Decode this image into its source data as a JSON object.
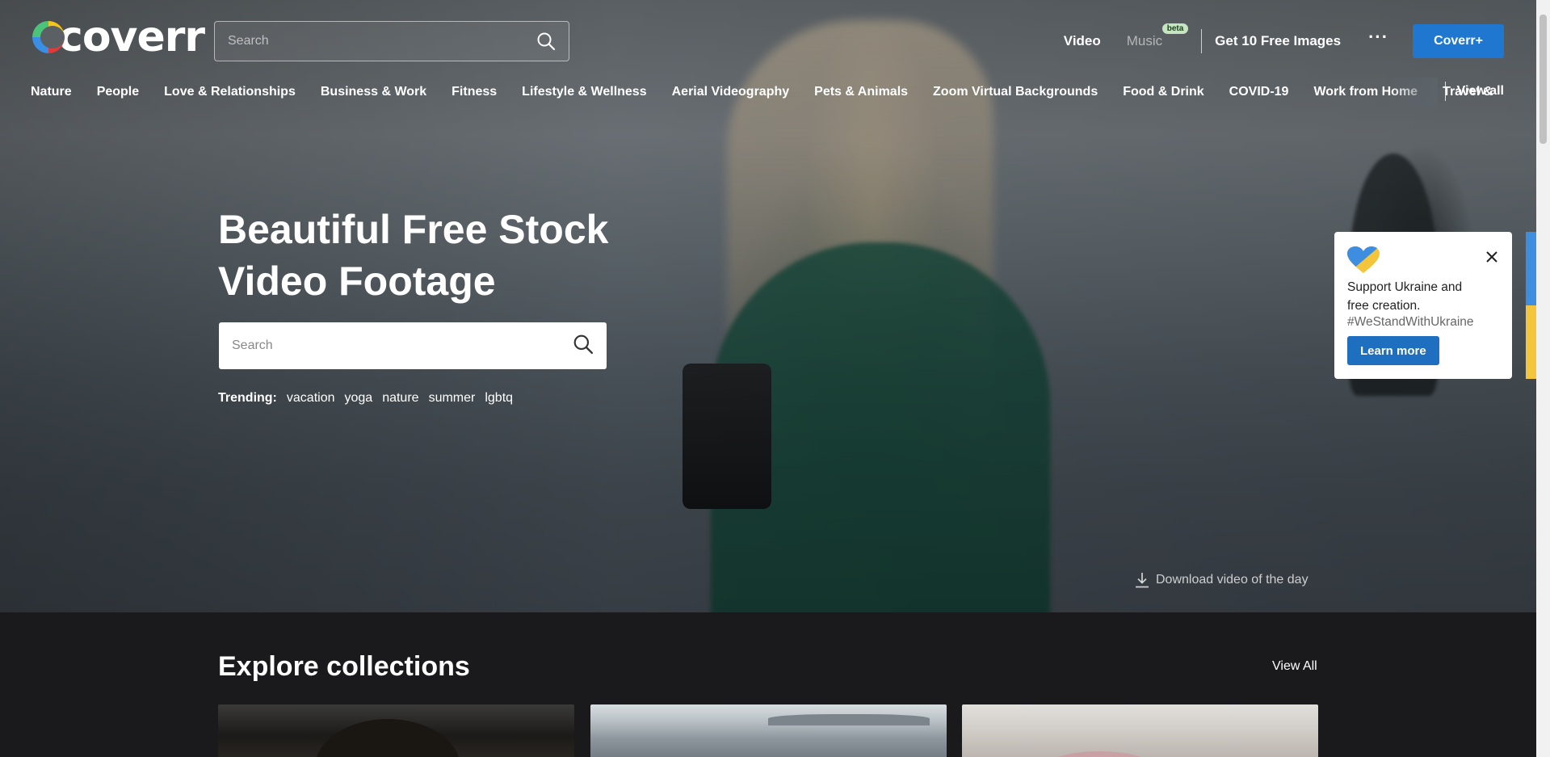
{
  "brand": {
    "logo_text": "coverr"
  },
  "header": {
    "search_placeholder": "Search",
    "nav": {
      "video": "Video",
      "music": "Music",
      "music_badge": "beta",
      "free_images": "Get 10 Free Images",
      "more": "···",
      "coverr_plus": "Coverr+"
    }
  },
  "categories": {
    "items": [
      "Nature",
      "People",
      "Love & Relationships",
      "Business & Work",
      "Fitness",
      "Lifestyle & Wellness",
      "Aerial Videography",
      "Pets & Animals",
      "Zoom Virtual Backgrounds",
      "Food & Drink",
      "COVID-19",
      "Work from Home",
      "Travel &"
    ],
    "view_all": "View all"
  },
  "hero": {
    "title_line1": "Beautiful Free Stock",
    "title_line2": "Video Footage",
    "search_placeholder": "Search",
    "trending_label": "Trending:",
    "trending_tags": [
      "vacation",
      "yoga",
      "nature",
      "summer",
      "lgbtq"
    ],
    "download_link": "Download video of the day"
  },
  "popup": {
    "message_line1": "Support Ukraine and",
    "message_line2": "free creation.",
    "hashtag": "#WeStandWithUkraine",
    "button": "Learn more",
    "heart_icon": "ukraine-heart-icon",
    "colors": {
      "blue": "#3d8ee0",
      "yellow": "#f2c53d"
    }
  },
  "collections": {
    "title": "Explore collections",
    "view_all": "View All"
  },
  "colors": {
    "accent": "#1f77d0",
    "page_background": "#1a1a1c"
  }
}
